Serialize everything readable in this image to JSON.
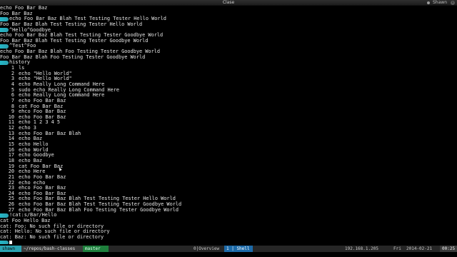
{
  "window": {
    "title": "Clase",
    "user": "Shawn"
  },
  "terminal": {
    "before_history": [
      {
        "type": "out",
        "text": "echo Foo Bar Baz"
      },
      {
        "type": "out",
        "text": "Foo Bar Baz"
      },
      {
        "type": "cmd",
        "text": "echo Foo Bar Baz Blah Test Testing Tester Hello World"
      },
      {
        "type": "out",
        "text": "Foo Bar Baz Blah Test Testing Tester Hello World"
      },
      {
        "type": "cmd",
        "text": "^Hello^Goodbye"
      },
      {
        "type": "out",
        "text": "echo Foo Bar Baz Blah Test Testing Tester Goodbye World"
      },
      {
        "type": "out",
        "text": "Foo Bar Baz Blah Test Testing Tester Goodbye World"
      },
      {
        "type": "cmd",
        "text": "^Test^Foo"
      },
      {
        "type": "out",
        "text": "echo Foo Bar Baz Blah Foo Testing Tester Goodbye World"
      },
      {
        "type": "out",
        "text": "Foo Bar Baz Blah Foo Testing Tester Goodbye World"
      },
      {
        "type": "cmd",
        "text": "history"
      }
    ],
    "history": [
      {
        "num": "1",
        "cmd": "ls"
      },
      {
        "num": "2",
        "cmd": "echo \"Hello World\""
      },
      {
        "num": "3",
        "cmd": "echo \"Hello World\""
      },
      {
        "num": "4",
        "cmd": "echo Really Long Command Here"
      },
      {
        "num": "5",
        "cmd": "sudo echo Really Long Command Here"
      },
      {
        "num": "6",
        "cmd": "echo Really Long Command Here"
      },
      {
        "num": "7",
        "cmd": "echo Foo Bar Baz"
      },
      {
        "num": "8",
        "cmd": "cat Foo Bar Baz"
      },
      {
        "num": "9",
        "cmd": "ehco Foo Bar Baz"
      },
      {
        "num": "10",
        "cmd": "echo Foo Bar Baz"
      },
      {
        "num": "11",
        "cmd": "echo 1 2 3 4 5"
      },
      {
        "num": "12",
        "cmd": "echo 3"
      },
      {
        "num": "13",
        "cmd": "echo Foo Bar Baz Blah"
      },
      {
        "num": "14",
        "cmd": "echo Baz"
      },
      {
        "num": "15",
        "cmd": "echo Hello"
      },
      {
        "num": "16",
        "cmd": "echo World"
      },
      {
        "num": "17",
        "cmd": "echo Goodbye"
      },
      {
        "num": "18",
        "cmd": "echo Baz"
      },
      {
        "num": "19",
        "cmd": "cat Foo Bar Baz"
      },
      {
        "num": "20",
        "cmd": "echo Here"
      },
      {
        "num": "21",
        "cmd": "echo Foo Bar Baz"
      },
      {
        "num": "22",
        "cmd": "echo echo"
      },
      {
        "num": "23",
        "cmd": "ehco Foo Bar Baz"
      },
      {
        "num": "24",
        "cmd": "echo Foo Bar Baz"
      },
      {
        "num": "25",
        "cmd": "echo Foo Bar Baz Blah Test Testing Tester Hello World"
      },
      {
        "num": "26",
        "cmd": "echo Foo Bar Baz Blah Test Testing Tester Goodbye World"
      },
      {
        "num": "27",
        "cmd": "echo Foo Bar Baz Blah Foo Testing Tester Goodbye World"
      }
    ],
    "after_history": [
      {
        "type": "cmd",
        "text": "!cat:s/Bar/Hello"
      },
      {
        "type": "out",
        "text": "cat Foo Hello Baz"
      },
      {
        "type": "out",
        "text": "cat: Foo: No such file or directory"
      },
      {
        "type": "out",
        "text": "cat: Hello: No such file or directory"
      },
      {
        "type": "out",
        "text": "cat: Baz: No such file or directory"
      }
    ]
  },
  "statusbar": {
    "session_user": "shawn",
    "path": "~/repos/bash-classes",
    "branch": "master",
    "window0": "0|Overview",
    "window1": "1 | Shell",
    "ip": "192.168.1.205",
    "day": "Fri",
    "date": "2014-02-21",
    "time": "00:25"
  },
  "colors": {
    "prompt_accent": "#25b7c6",
    "branch_green": "#1e7f3c",
    "active_window_blue": "#1c6aa8",
    "background": "#000000"
  }
}
